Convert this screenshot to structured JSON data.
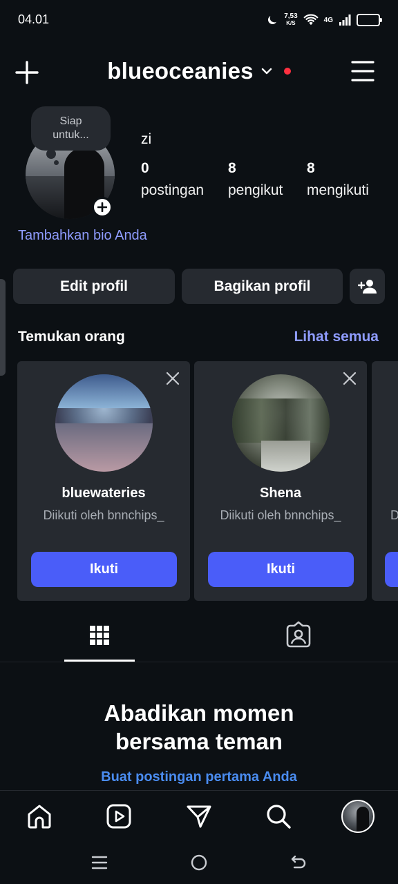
{
  "status_bar": {
    "time": "04.01",
    "speed_value": "7,53",
    "speed_unit": "K/S",
    "network": "4G",
    "battery": "71",
    "battery_level": 0.71
  },
  "header": {
    "username": "blueoceanies"
  },
  "profile": {
    "note_line1": "Siap",
    "note_line2": "untuk...",
    "display_name": "zi",
    "stats": [
      {
        "num": "0",
        "label": "postingan"
      },
      {
        "num": "8",
        "label": "pengikut"
      },
      {
        "num": "8",
        "label": "mengikuti"
      }
    ],
    "bio_link": "Tambahkan bio Anda"
  },
  "actions": {
    "edit": "Edit profil",
    "share": "Bagikan profil"
  },
  "discover": {
    "title": "Temukan orang",
    "see_all": "Lihat semua",
    "cards": [
      {
        "name": "bluewateries",
        "sub": "Diikuti oleh bnnchips_",
        "button": "Ikuti"
      },
      {
        "name": "Shena",
        "sub": "Diikuti oleh bnnchips_",
        "button": "Ikuti"
      }
    ],
    "partial_letter": "D"
  },
  "empty_state": {
    "title_line1": "Abadikan momen",
    "title_line2": "bersama teman",
    "link": "Buat postingan pertama Anda"
  },
  "icons": {
    "header": [
      "plus-icon",
      "chevron-down-icon",
      "menu-icon"
    ],
    "tabs": [
      "grid-icon",
      "tagged-icon"
    ],
    "bottom_nav": [
      "home-icon",
      "reels-icon",
      "send-icon",
      "search-icon",
      "profile-avatar"
    ],
    "system_nav": [
      "recents-icon",
      "home-circle-icon",
      "back-icon"
    ]
  },
  "colors": {
    "background": "#0c1014",
    "surface": "#262a30",
    "accent": "#4a5df9",
    "link": "#8f9cff",
    "notification_dot": "#ff3040"
  }
}
